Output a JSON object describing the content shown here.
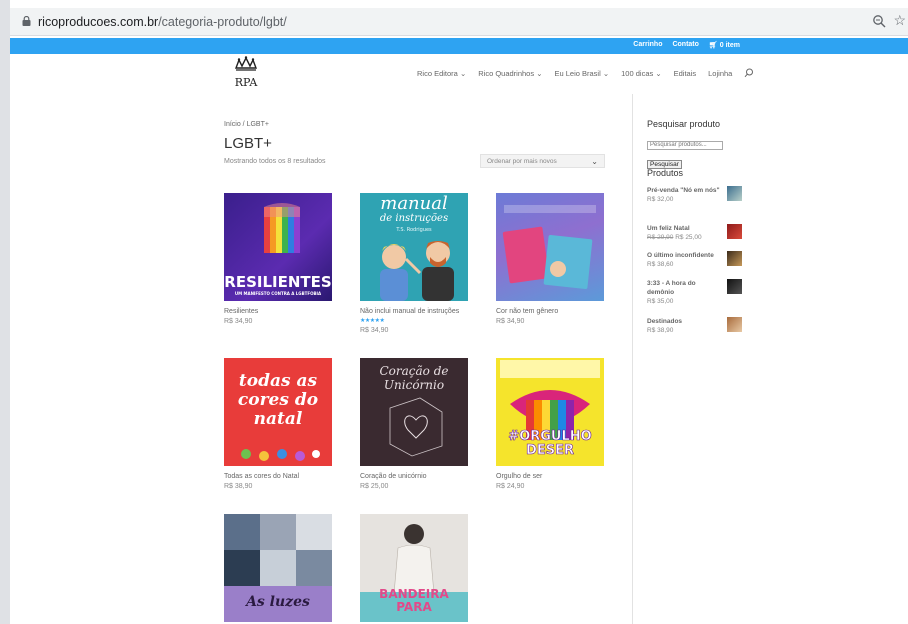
{
  "browser": {
    "url_host": "ricoproducoes.com.br",
    "url_path": "/categoria-produto/lgbt/"
  },
  "topbar": {
    "cart_label": "Carrinho",
    "contact_label": "Contato",
    "cart_count": "0 item"
  },
  "nav": {
    "logo_text": "RPA",
    "items": [
      "Rico Editora",
      "Rico Quadrinhos",
      "Eu Leio Brasil",
      "100 dicas",
      "Editais",
      "Lojinha"
    ]
  },
  "page": {
    "breadcrumb": "Início / LGBT+",
    "title": "LGBT+",
    "result_count": "Mostrando todos os 8 resultados",
    "orderby": "Ordenar por mais novos"
  },
  "products": [
    {
      "name": "Resilientes",
      "price": "R$ 34,90",
      "cover_text": "RESILIENTES",
      "cover_sub": "UM MANIFESTO CONTRA A LGBTFOBIA"
    },
    {
      "name": "Não inclui manual de instruções",
      "price": "R$ 34,90",
      "rating": "★★★★★",
      "cover_text": "manual",
      "cover_sub": "de instruções",
      "cover_author": "T.S. Rodrigues"
    },
    {
      "name": "Cor não tem gênero",
      "price": "R$ 34,90"
    },
    {
      "name": "Todas as cores do Natal",
      "price": "R$ 38,90",
      "cover_text": "todas as cores do natal"
    },
    {
      "name": "Coração de unicórnio",
      "price": "R$ 25,00",
      "cover_text": "Coração de Unicórnio"
    },
    {
      "name": "Orgulho de ser",
      "price": "R$ 24,90",
      "cover_text": "#ORGULHO DESER"
    },
    {
      "name": "",
      "price": "",
      "cover_text": "As luzes"
    },
    {
      "name": "",
      "price": "",
      "cover_text": "BANDEIRA PARA"
    }
  ],
  "sidebar": {
    "search_title": "Pesquisar produto",
    "search_placeholder": "Pesquisar produtos...",
    "search_button": "Pesquisar",
    "products_title": "Produtos",
    "items": [
      {
        "name": "Pré-venda \"Nó em nós\"",
        "price": "R$ 32,00",
        "old_price": ""
      },
      {
        "name": "Um feliz Natal",
        "price": "R$ 25,00",
        "old_price": "R$ 29,90"
      },
      {
        "name": "O último inconfidente",
        "price": "R$ 38,60",
        "old_price": ""
      },
      {
        "name": "3:33 - A hora do demônio",
        "price": "R$ 35,00",
        "old_price": ""
      },
      {
        "name": "Destinados",
        "price": "R$ 38,90",
        "old_price": ""
      }
    ]
  },
  "colors": {
    "accent": "#2ea3f2",
    "text": "#666666"
  }
}
